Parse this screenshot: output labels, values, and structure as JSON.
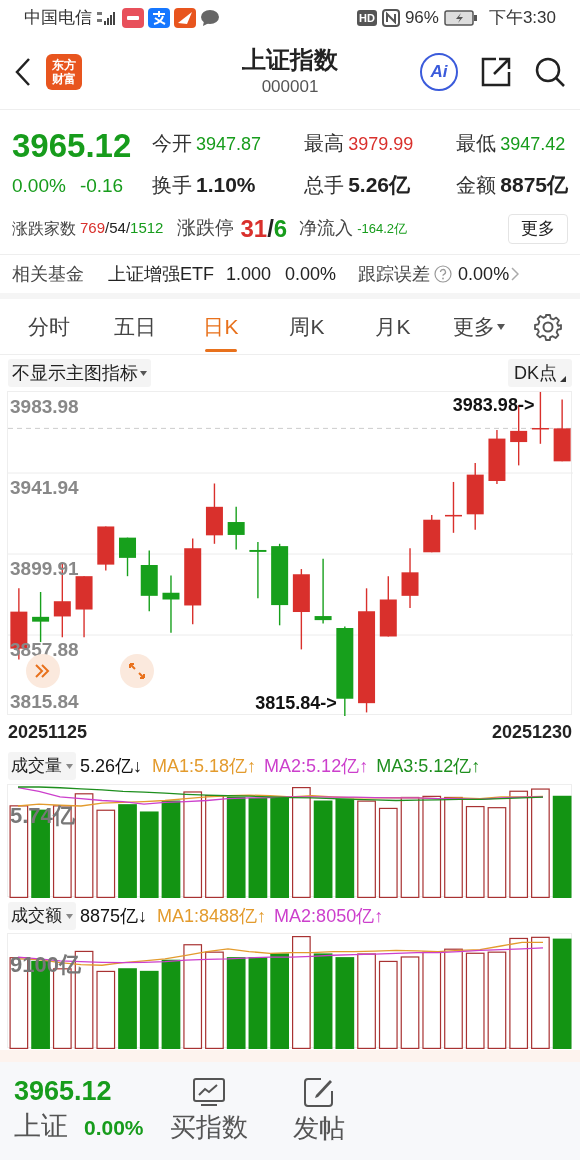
{
  "status_bar": {
    "carrier": "中国电信",
    "hd": "HD",
    "battery": "96%",
    "time": "下午3:30"
  },
  "header": {
    "logo_lines": [
      "东方",
      "财富"
    ],
    "title": "上证指数",
    "code": "000001",
    "ai_label": "Ai"
  },
  "quote": {
    "price": "3965.12",
    "change_pct": "0.00%",
    "change": "-0.16",
    "color": "#179c1c",
    "stats": [
      {
        "label": "今开",
        "value": "3947.87",
        "color": "#179c1c"
      },
      {
        "label": "最高",
        "value": "3979.99",
        "color": "#d9302c"
      },
      {
        "label": "最低",
        "value": "3947.42",
        "color": "#179c1c"
      },
      {
        "label": "换手",
        "value": "1.10%",
        "color": "#222222"
      },
      {
        "label": "总手",
        "value": "5.26亿",
        "color": "#222222"
      },
      {
        "label": "金额",
        "value": "8875亿",
        "color": "#222222"
      }
    ],
    "breadth": {
      "label": "涨跌家数",
      "separator": "/",
      "parts": [
        {
          "text": "769",
          "color": "#d9302c"
        },
        {
          "text": "54",
          "color": "#222222"
        },
        {
          "text": "1512",
          "color": "#179c1c"
        }
      ]
    },
    "limits": {
      "label": "涨跌停",
      "separator": "/",
      "parts": [
        {
          "text": "31",
          "color": "#d9302c"
        },
        {
          "text": "6",
          "color": "#179c1c"
        }
      ]
    },
    "inflow": {
      "label": "净流入",
      "value": "-164.2亿",
      "color": "#179c1c"
    },
    "more_button": "更多"
  },
  "fund": {
    "label": "相关基金",
    "name": "上证增强ETF",
    "price": "1.000",
    "change": "0.00%",
    "error_label": "跟踪误差",
    "error_value": "0.00%"
  },
  "tabs": [
    {
      "label": "分时",
      "selected": false
    },
    {
      "label": "五日",
      "selected": false
    },
    {
      "label": "日K",
      "selected": true
    },
    {
      "label": "周K",
      "selected": false
    },
    {
      "label": "月K",
      "selected": false
    },
    {
      "label": "更多",
      "selected": false,
      "kind": "dropdown"
    }
  ],
  "indicator_select": "不显示主图指标",
  "dk_button": "DK点",
  "kline": {
    "y_labels": [
      "3983.98",
      "3941.94",
      "3899.91",
      "3857.88",
      "3815.84"
    ],
    "dates": [
      "20251125",
      "20251230"
    ],
    "high_marker": "3983.98->",
    "low_marker": "3815.84->"
  },
  "volume": {
    "label": "成交量",
    "value": "5.26亿↓",
    "axis_label": "5.74亿",
    "mas": [
      {
        "text": "MA1:5.18亿↑",
        "color": "#e39b2d"
      },
      {
        "text": "MA2:5.12亿↑",
        "color": "#cc3fcc"
      },
      {
        "text": "MA3:5.12亿↑",
        "color": "#1e8f1e"
      }
    ]
  },
  "amount": {
    "label": "成交额",
    "value": "8875亿↓",
    "axis_label": "9100亿",
    "mas": [
      {
        "text": "MA1:8488亿↑",
        "color": "#e39b2d"
      },
      {
        "text": "MA2:8050亿↑",
        "color": "#cc3fcc"
      }
    ]
  },
  "bottom_bar": {
    "price": "3965.12",
    "name": "上证",
    "change_pct": "0.00%",
    "color": "#179c1c",
    "items": [
      {
        "label": "买指数",
        "kind": "chart"
      },
      {
        "label": "发帖",
        "kind": "edit"
      }
    ]
  }
}
